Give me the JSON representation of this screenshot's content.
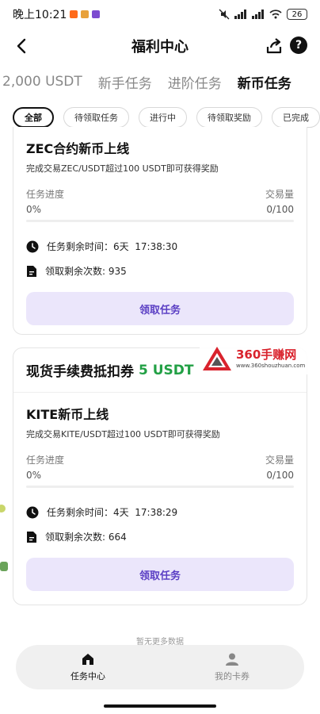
{
  "status_bar": {
    "time": "晚上10:21",
    "battery": "26",
    "app_icon_colors": [
      "#ff6a1a",
      "#e8a13a",
      "#7c4bd0"
    ]
  },
  "header": {
    "title": "福利中心",
    "back_icon": "back-arrow-icon",
    "share_icon": "share-icon",
    "help_icon": "help-icon",
    "help_glyph": "?"
  },
  "tabs": [
    {
      "label": "2,000 USDT",
      "active": false
    },
    {
      "label": "新手任务",
      "active": false
    },
    {
      "label": "进阶任务",
      "active": false
    },
    {
      "label": "新币任务",
      "active": true
    }
  ],
  "filters": [
    {
      "label": "全部",
      "active": true
    },
    {
      "label": "待领取任务",
      "active": false
    },
    {
      "label": "进行中",
      "active": false
    },
    {
      "label": "待领取奖励",
      "active": false
    },
    {
      "label": "已完成",
      "active": false
    }
  ],
  "cards": [
    {
      "title": "ZEC合约新币上线",
      "description": "完成交易ZEC/USDT超过100 USDT即可获得奖励",
      "progress_label": "任务进度",
      "progress_value": "0%",
      "volume_label": "交易量",
      "volume_value": "0/100",
      "progress_fraction": 0,
      "time_label": "任务剩余时间：",
      "time_value": "6天  17:38:30",
      "claims_label": "领取剩余次数: ",
      "claims_value": "935",
      "button_label": "领取任务"
    },
    {
      "banner_label": "现货手续费抵扣券",
      "banner_amount": "5 USDT",
      "title": "KITE新币上线",
      "description": "完成交易KITE/USDT超过100 USDT即可获得奖励",
      "progress_label": "任务进度",
      "progress_value": "0%",
      "volume_label": "交易量",
      "volume_value": "0/100",
      "progress_fraction": 0,
      "time_label": "任务剩余时间：",
      "time_value": "4天  17:38:29",
      "claims_label": "领取剩余次数: ",
      "claims_value": "664",
      "button_label": "领取任务"
    }
  ],
  "watermark": {
    "title": "360手赚网",
    "url": "www.360shouzhuan.com"
  },
  "no_more_text": "暂无更多数据",
  "bottom_nav": [
    {
      "label": "任务中心",
      "icon": "home-icon",
      "active": true
    },
    {
      "label": "我的卡券",
      "icon": "user-icon",
      "active": false
    }
  ],
  "colors": {
    "accent": "#5b3fc4",
    "button_bg": "#ebe6fb",
    "green": "#22a045",
    "brand_red": "#d9232d"
  }
}
